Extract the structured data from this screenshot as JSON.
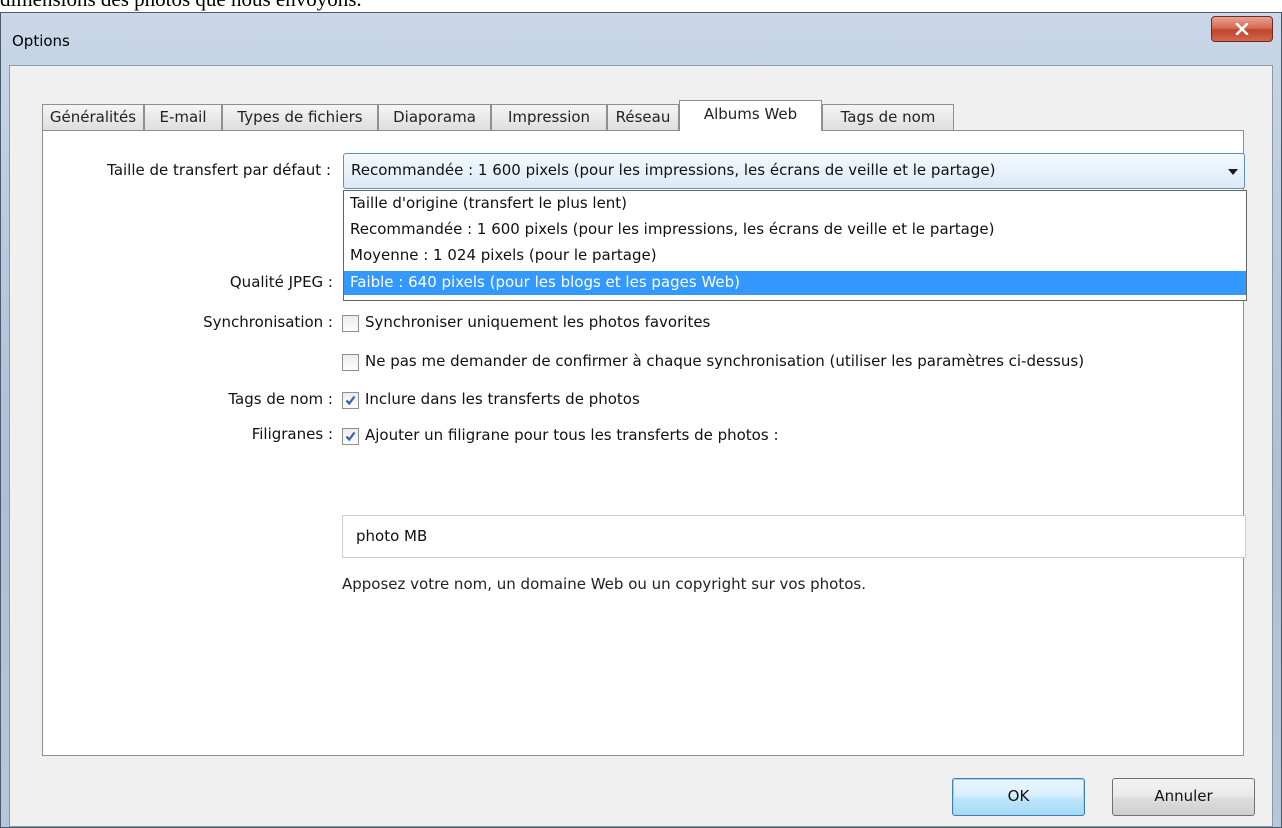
{
  "page_caption": "dimensions des photos que nous envoyons.",
  "window": {
    "title": "Options",
    "close_label": "x"
  },
  "tabs": [
    {
      "label": "Généralités",
      "active": false
    },
    {
      "label": "E-mail",
      "active": false
    },
    {
      "label": "Types de fichiers",
      "active": false
    },
    {
      "label": "Diaporama",
      "active": false
    },
    {
      "label": "Impression",
      "active": false
    },
    {
      "label": "Réseau",
      "active": false
    },
    {
      "label": "Albums Web",
      "active": true
    },
    {
      "label": "Tags de nom",
      "active": false
    }
  ],
  "form": {
    "transfer_size": {
      "label": "Taille de transfert par défaut :",
      "value": "Recommandée : 1 600 pixels (pour les impressions, les écrans de veille et le partage)",
      "options": [
        "Taille d'origine (transfert le plus lent)",
        "Recommandée : 1 600 pixels (pour les impressions, les écrans de veille et le partage)",
        "Moyenne : 1 024 pixels (pour le partage)",
        "Faible : 640 pixels (pour les blogs et les pages Web)"
      ],
      "highlighted_option": 3
    },
    "jpeg_quality": {
      "label": "Qualité JPEG :"
    },
    "sync": {
      "label": "Synchronisation :",
      "favorites_only": {
        "label": "Synchroniser uniquement les photos favorites",
        "checked": false
      },
      "no_confirm": {
        "label": "Ne pas me demander de confirmer à chaque synchronisation (utiliser les paramètres ci-dessus)",
        "checked": false
      }
    },
    "name_tags": {
      "label": "Tags de nom :",
      "include": {
        "label": "Inclure dans les transferts de photos",
        "checked": true
      }
    },
    "watermarks": {
      "label": "Filigranes :",
      "add": {
        "label": "Ajouter un filigrane pour tous les transferts de photos :",
        "checked": true
      },
      "text_value": "photo MB",
      "hint": "Apposez votre nom, un domaine Web ou un copyright sur vos photos."
    }
  },
  "buttons": {
    "ok": "OK",
    "cancel": "Annuler"
  },
  "colors": {
    "selection": "#3399ff",
    "close_button": "#c7452d",
    "default_button_border": "#3c7fb1"
  }
}
